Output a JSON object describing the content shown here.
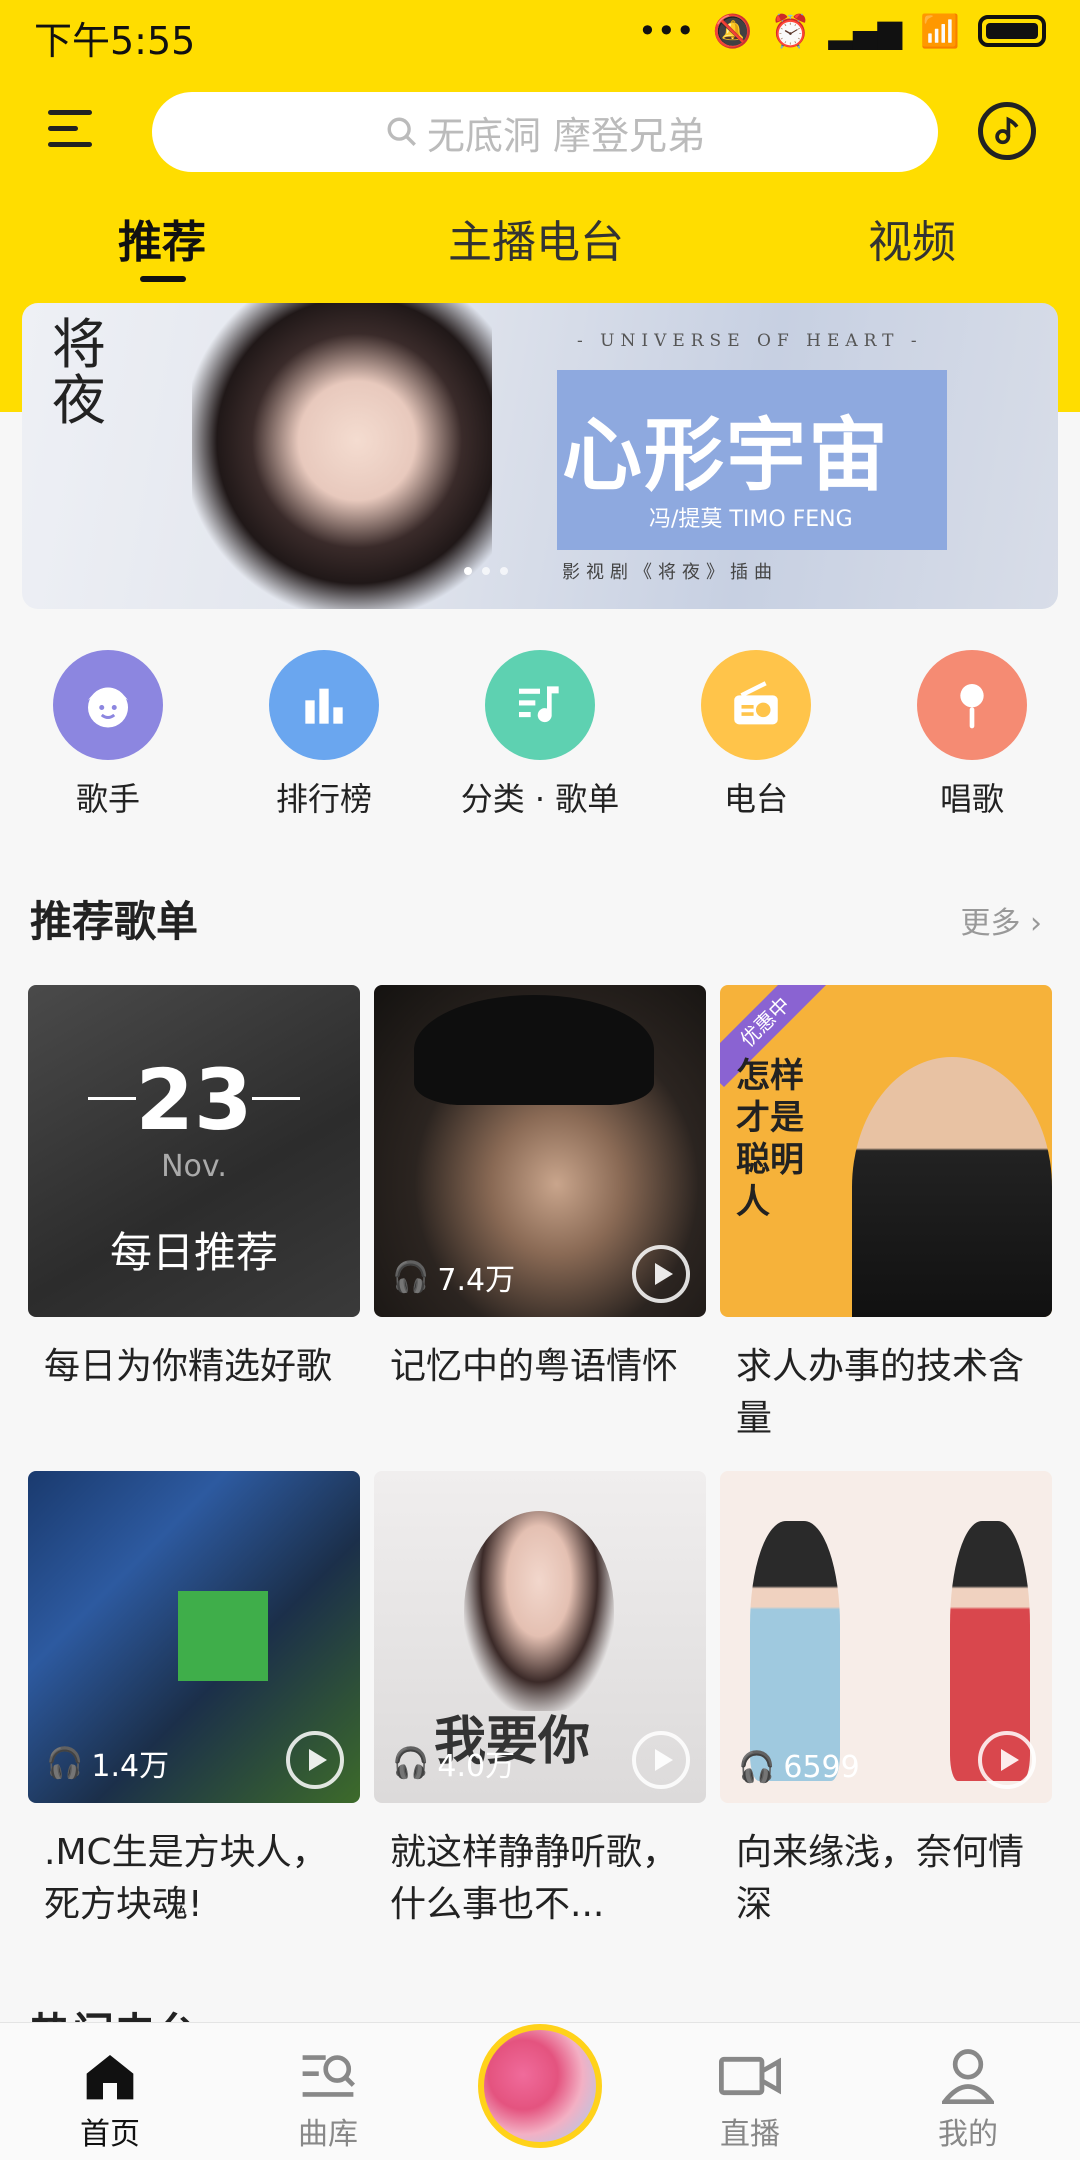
{
  "status": {
    "time": "下午5:55"
  },
  "search": {
    "placeholder": "无底洞 摩登兄弟"
  },
  "tabs": [
    {
      "label": "推荐"
    },
    {
      "label": "主播电台"
    },
    {
      "label": "视频"
    }
  ],
  "banner": {
    "calligraphy": "将夜",
    "universe": "- UNIVERSE OF HEART -",
    "title": "心形宇宙",
    "artist": "冯/提莫 TIMO FENG",
    "subtitle": "影视剧《将夜》插曲"
  },
  "categories": [
    {
      "label": "歌手",
      "color": "#8c86e0",
      "icon": "singer-icon"
    },
    {
      "label": "排行榜",
      "color": "#6aa6ef",
      "icon": "chart-icon"
    },
    {
      "label": "分类 · 歌单",
      "color": "#5ed1b1",
      "icon": "playlist-icon"
    },
    {
      "label": "电台",
      "color": "#ffc44a",
      "icon": "radio-icon"
    },
    {
      "label": "唱歌",
      "color": "#f58b73",
      "icon": "microphone-icon"
    }
  ],
  "section": {
    "title": "推荐歌单",
    "more": "更多"
  },
  "daily": {
    "day": "23",
    "month": "Nov.",
    "text": "每日推荐"
  },
  "playlists": [
    {
      "title": "每日为你精选好歌",
      "plays": ""
    },
    {
      "title": "记忆中的粤语情怀",
      "plays": "7.4万"
    },
    {
      "title": "求人办事的技术含量",
      "plays": "",
      "badge": "优惠中",
      "cover_text": "怎样才是聪明人"
    },
    {
      "title": ".MC生是方块人，死方块魂!",
      "plays": "1.4万"
    },
    {
      "title": "就这样静静听歌，什么事也不...",
      "plays": "4.0万",
      "cover_text": "我要你"
    },
    {
      "title": "向来缘浅，奈何情深",
      "plays": "6599"
    }
  ],
  "next_section": {
    "title": "热门电台"
  },
  "nav": [
    {
      "label": "首页",
      "active": true
    },
    {
      "label": "曲库",
      "active": false
    },
    {
      "label": "直播",
      "active": false
    },
    {
      "label": "我的",
      "active": false
    }
  ]
}
